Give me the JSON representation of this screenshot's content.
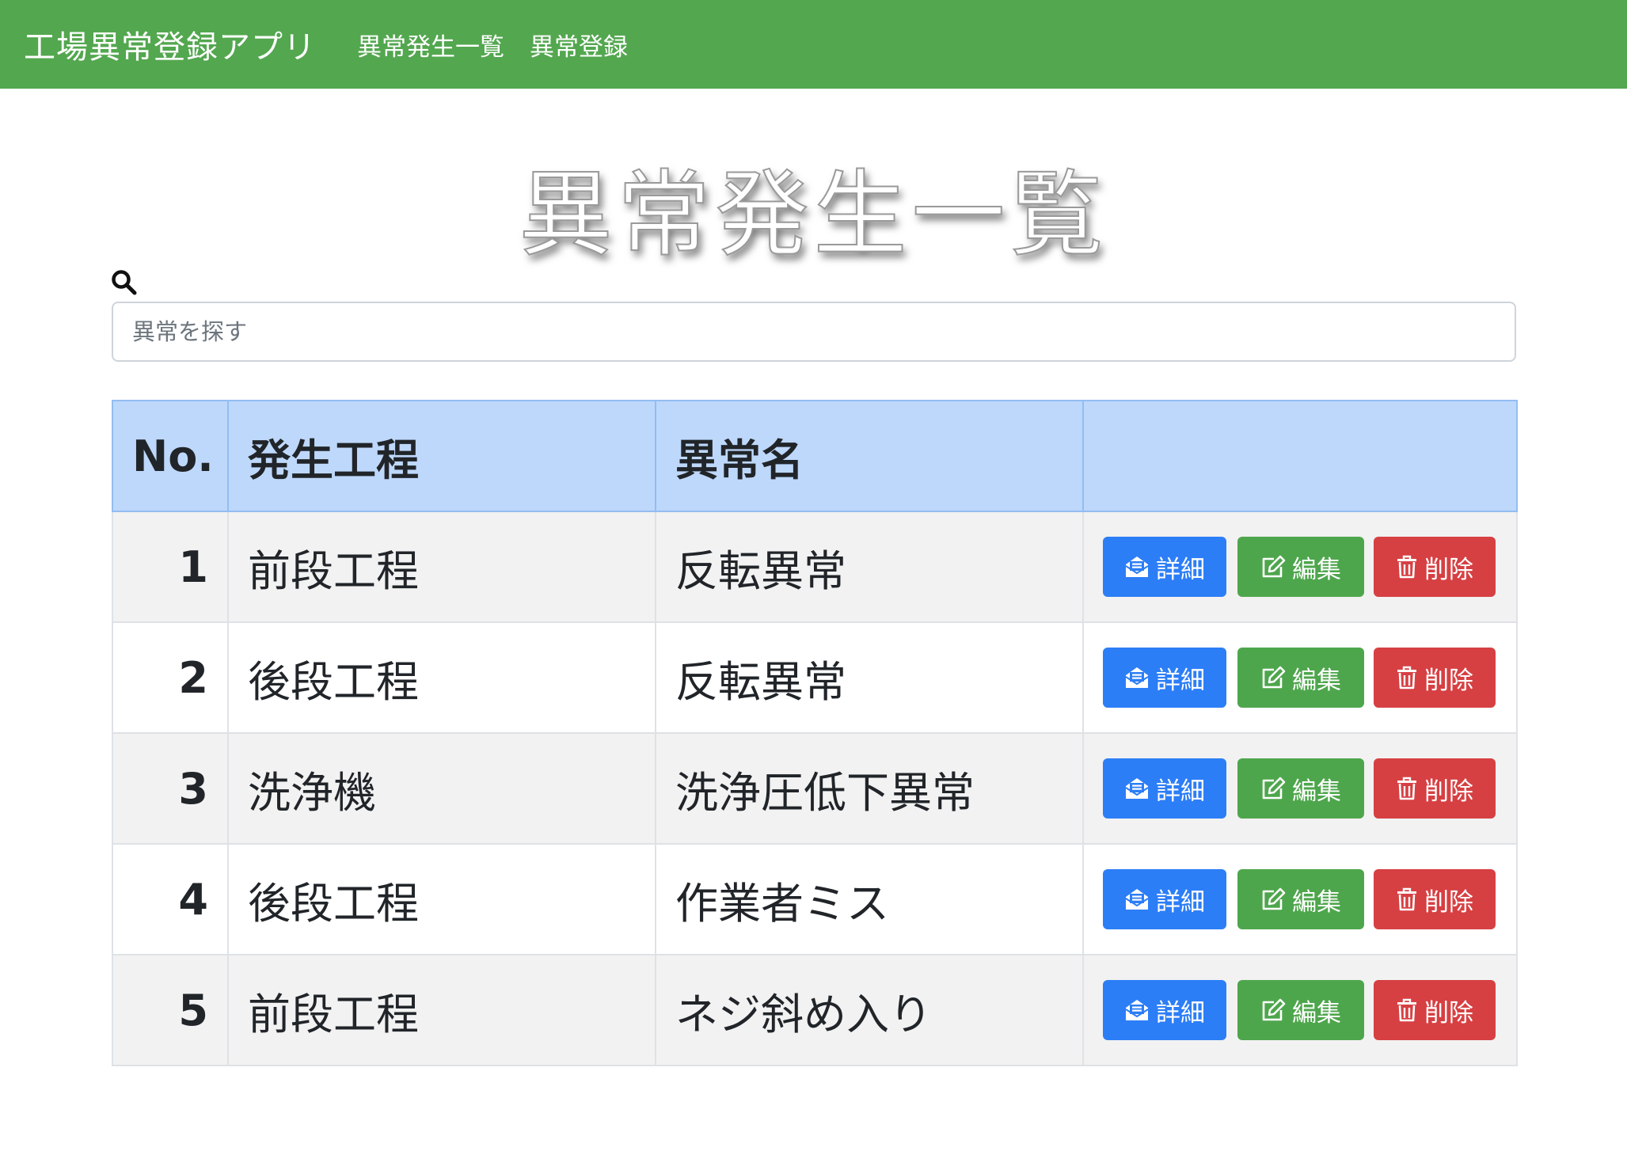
{
  "navbar": {
    "brand": "工場異常登録アプリ",
    "links": [
      "異常発生一覧",
      "異常登録"
    ],
    "color": "#53a74f"
  },
  "page": {
    "title": "異常発生一覧"
  },
  "search": {
    "icon": "search-icon",
    "placeholder": "異常を探す"
  },
  "table": {
    "headers": [
      "No.",
      "発生工程",
      "異常名",
      ""
    ],
    "header_color": "#bed8fb",
    "rows": [
      {
        "no": "1",
        "process": "前段工程",
        "name": "反転異常"
      },
      {
        "no": "2",
        "process": "後段工程",
        "name": "反転異常"
      },
      {
        "no": "3",
        "process": "洗浄機",
        "name": "洗浄圧低下異常"
      },
      {
        "no": "4",
        "process": "後段工程",
        "name": "作業者ミス"
      },
      {
        "no": "5",
        "process": "前段工程",
        "name": "ネジ斜め入り"
      }
    ],
    "actions": {
      "detail": {
        "label": "詳細",
        "icon": "envelope-open-text-icon",
        "color": "#2c7ef6"
      },
      "edit": {
        "label": "編集",
        "icon": "edit-icon",
        "color": "#4ea64c"
      },
      "delete": {
        "label": "削除",
        "icon": "trash-icon",
        "color": "#d64043"
      }
    }
  }
}
